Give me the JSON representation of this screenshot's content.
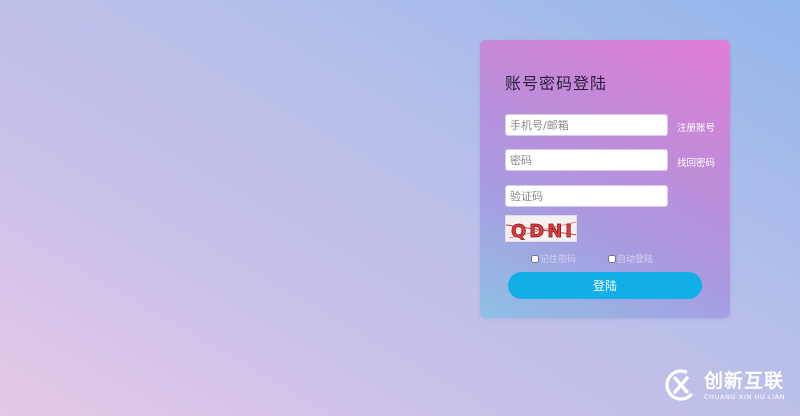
{
  "login": {
    "title": "账号密码登陆",
    "account_placeholder": "手机号/邮箱",
    "password_placeholder": "密码",
    "captcha_placeholder": "验证码",
    "register_link": "注册账号",
    "forgot_link": "找回密码",
    "captcha_text": "QDNI",
    "remember_label": "记住密码",
    "auto_login_label": "自动登陆",
    "submit_label": "登陆"
  },
  "watermark": {
    "brand_cn": "创新互联",
    "brand_en": "CHUANG XIN HU LIAN"
  },
  "colors": {
    "button": "#12aee8",
    "card_top": "#e27cd9",
    "card_bottom": "#8ec1e6"
  }
}
